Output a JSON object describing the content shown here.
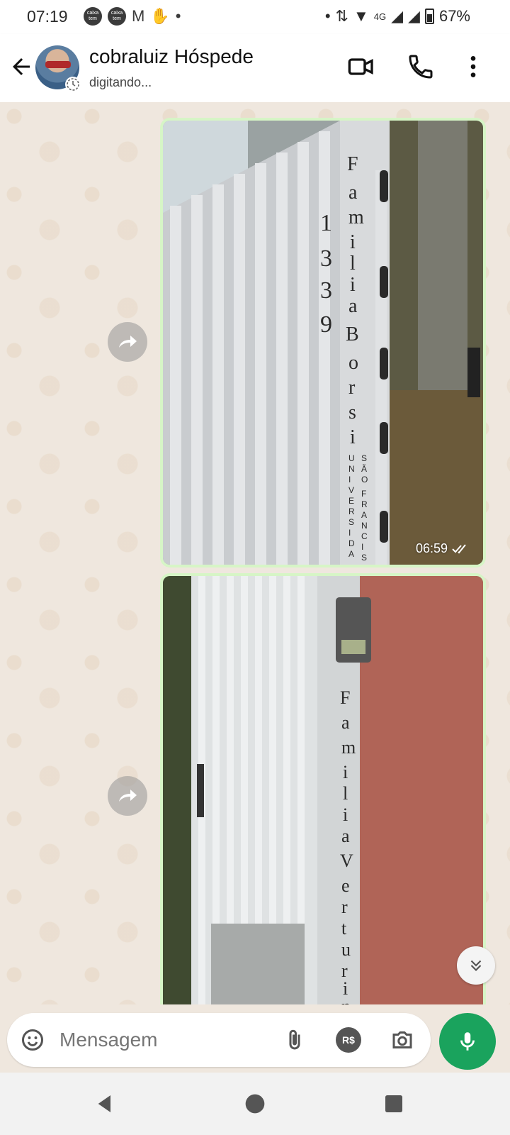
{
  "status_bar": {
    "time": "07:19",
    "badge1": "caixa tem",
    "badge2": "caixa tem",
    "network": "4G",
    "battery": "67%"
  },
  "header": {
    "contact_name": "cobraluiz Hóspede",
    "status": "digitando..."
  },
  "messages": [
    {
      "type": "image",
      "direction": "outgoing",
      "forwarded": true,
      "time": "06:59",
      "read": true,
      "image_text": [
        "1339",
        "Família Borsi",
        "Universidade São Francisco"
      ]
    },
    {
      "type": "image",
      "direction": "outgoing",
      "forwarded": true,
      "time": "",
      "image_text": [
        "Família Verturine"
      ]
    }
  ],
  "composer": {
    "placeholder": "Mensagem",
    "currency_label": "R$"
  },
  "colors": {
    "accent_green": "#1aa35d",
    "bubble_green": "#d6f5c6",
    "chat_bg": "#efe7de"
  }
}
